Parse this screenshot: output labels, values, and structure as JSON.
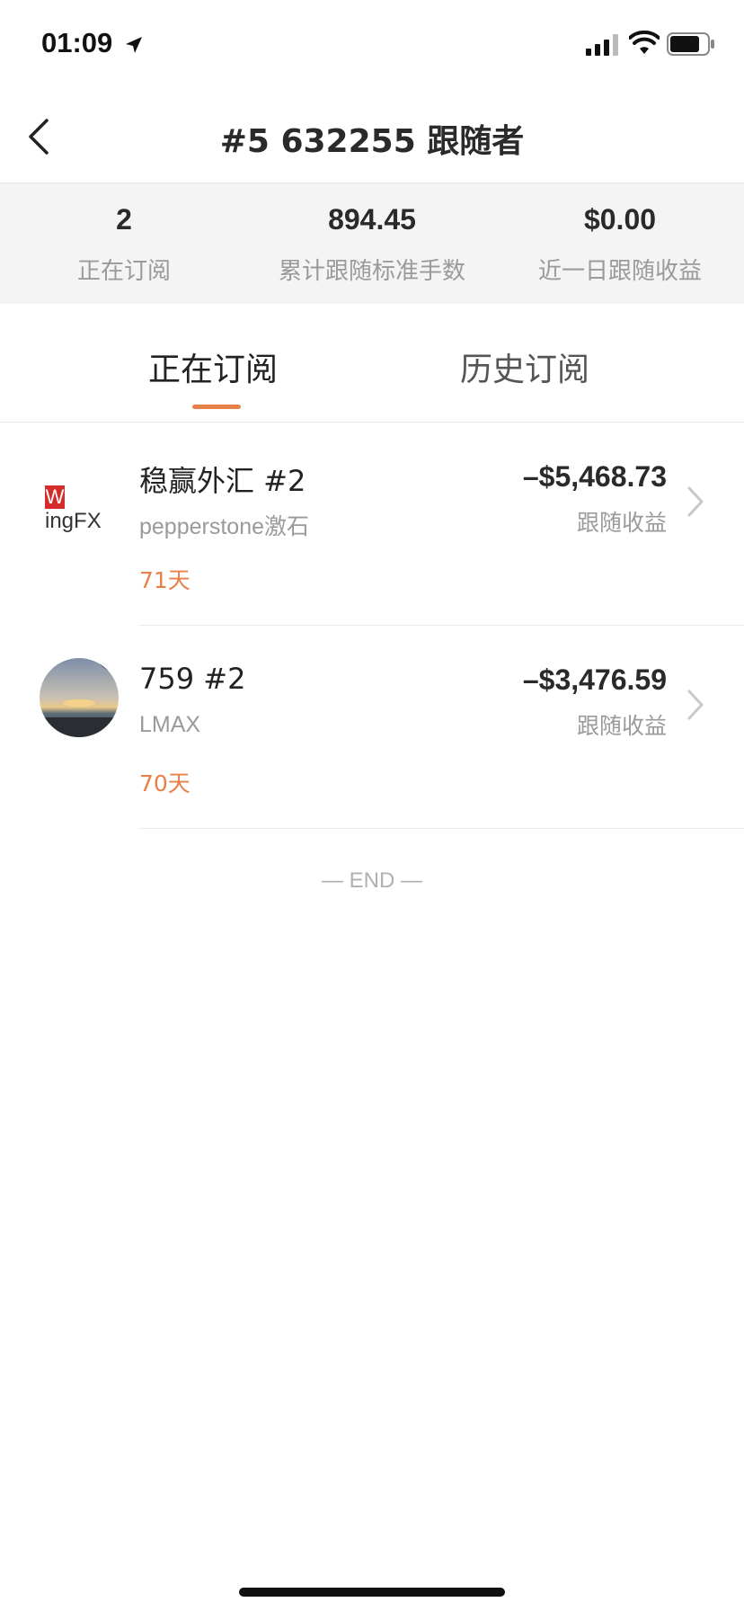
{
  "status_bar": {
    "time": "01:09"
  },
  "header": {
    "title": "#5 632255 跟随者"
  },
  "stats": [
    {
      "value": "2",
      "label": "正在订阅"
    },
    {
      "value": "894.45",
      "label": "累计跟随标准手数"
    },
    {
      "value": "$0.00",
      "label": "近一日跟随收益"
    }
  ],
  "tabs": [
    {
      "label": "正在订阅",
      "active": true
    },
    {
      "label": "历史订阅",
      "active": false
    }
  ],
  "subscriptions": [
    {
      "logo_text": "WingFX",
      "name": "稳赢外汇 #2",
      "broker": "pepperstone激石",
      "days": "71天",
      "amount": "–$5,468.73",
      "amount_label": "跟随收益"
    },
    {
      "name": "759 #2",
      "broker": "LMAX",
      "days": "70天",
      "amount": "–$3,476.59",
      "amount_label": "跟随收益"
    }
  ],
  "end_text": "— END —",
  "colors": {
    "accent": "#e8804a",
    "stats_bg": "#f4f4f4"
  }
}
